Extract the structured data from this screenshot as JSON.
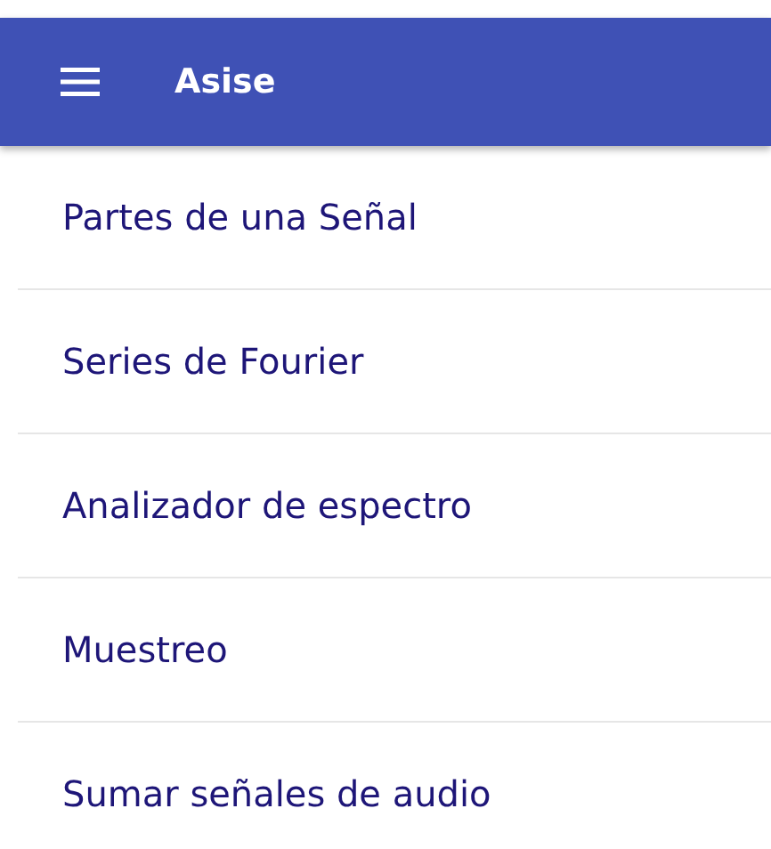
{
  "app_bar": {
    "title": "Asise"
  },
  "menu_items": [
    {
      "label": "Partes de una Señal"
    },
    {
      "label": "Series de Fourier"
    },
    {
      "label": "Analizador de espectro"
    },
    {
      "label": "Muestreo"
    },
    {
      "label": "Sumar señales de audio"
    }
  ]
}
